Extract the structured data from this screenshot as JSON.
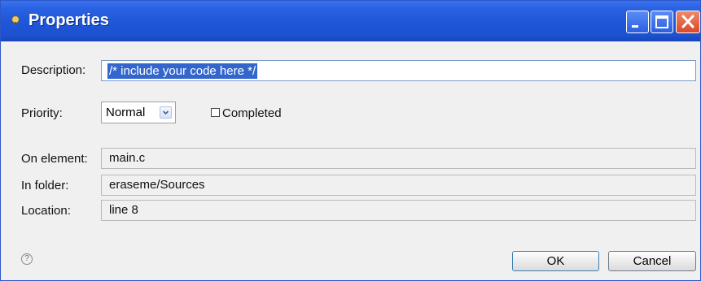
{
  "window": {
    "title": "Properties",
    "icon": "properties-task-icon",
    "controls": {
      "minimize": "minimize-icon",
      "maximize": "maximize-icon",
      "close": "close-icon"
    },
    "colors": {
      "titlebar": "#2a62e2",
      "close": "#d9482a",
      "selection": "#3366cc"
    }
  },
  "form": {
    "description_label": "Description:",
    "description_value": "/* include your code here */",
    "priority_label": "Priority:",
    "priority_value": "Normal",
    "completed_label": "Completed",
    "completed_checked": false,
    "on_element_label": "On element:",
    "on_element_value": "main.c",
    "in_folder_label": "In folder:",
    "in_folder_value": "eraseme/Sources",
    "location_label": "Location:",
    "location_value": "line 8"
  },
  "footer": {
    "help_icon": "help-icon",
    "help_glyph": "?",
    "ok_label": "OK",
    "cancel_label": "Cancel"
  }
}
